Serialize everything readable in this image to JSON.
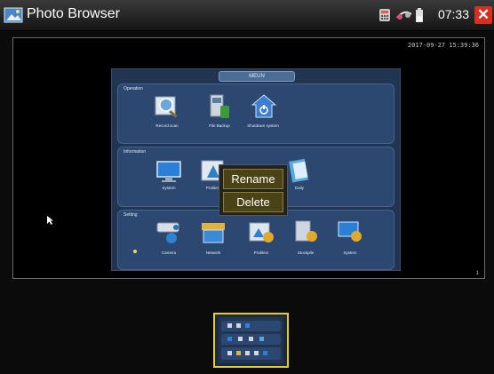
{
  "titlebar": {
    "title": "Photo Browser",
    "time": "07:33",
    "close_symbol": "✕",
    "status_icons": [
      "calculator-icon",
      "network-icon",
      "battery-icon"
    ]
  },
  "viewer": {
    "timestamp": "2017-09-27 15:39:36",
    "page": "1"
  },
  "screenshot": {
    "menu_title": "MEUN",
    "sections": [
      {
        "label": "Operation",
        "items": [
          "Record scan",
          "File Backup",
          "Shutdown system"
        ]
      },
      {
        "label": "Information",
        "items": [
          "System",
          "Problem",
          "",
          "Daily"
        ]
      },
      {
        "label": "Setting",
        "items": [
          "Camera",
          "Network",
          "Problem",
          "Stockpile",
          "System"
        ]
      }
    ]
  },
  "context_menu": {
    "rename_label": "Rename",
    "delete_label": "Delete"
  },
  "colors": {
    "accent": "#e6cc2c",
    "close": "#d82d1f",
    "panel": "#2c4770"
  }
}
